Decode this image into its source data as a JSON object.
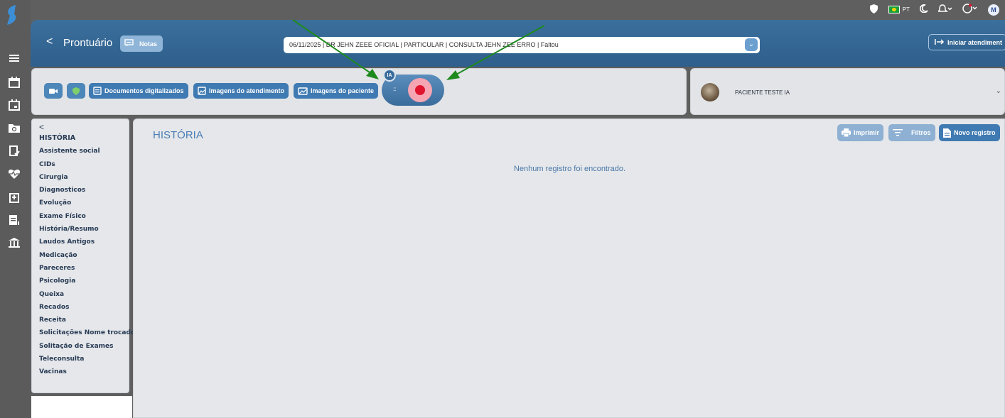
{
  "topbar": {
    "lang": "PT",
    "user_initial": "M"
  },
  "header": {
    "back_label": "<",
    "title": "Prontuário",
    "notas_label": "Notas",
    "consulta_value": "06/11/2025 | DR JEHN ZEEE OFICIAL | PARTICULAR | CONSULTA JEHN ZEE ERRO | Faltou",
    "iniciar_label": "Iniciar atendiment"
  },
  "toolbar": {
    "documentos_label": "Documentos digitalizados",
    "imagens_atendimento_label": "Imagens do atendimento",
    "imagens_paciente_label": "Imagens do paciente",
    "ia_badge": "IA"
  },
  "patient": {
    "name": "PACIENTE TESTE IA"
  },
  "menu": {
    "back": "<",
    "items": [
      "HISTÓRIA",
      "Assistente social",
      "CIDs",
      "Cirurgia",
      "Diagnosticos",
      "Evolução",
      "Exame Físico",
      "História/Resumo",
      "Laudos Antigos",
      "Medicação",
      "Pareceres",
      "Psicologia",
      "Queixa",
      "Recados",
      "Receita",
      "Solicitações Nome trocado",
      "Solitação de Exames",
      "Teleconsulta",
      "Vacinas"
    ]
  },
  "main": {
    "title": "HISTÓRIA",
    "empty_message": "Nenhum registro foi encontrado.",
    "imprimir_label": "Imprimir",
    "filtros_label": "Filtros",
    "novo_registro_label": "Novo registro"
  },
  "colors": {
    "header_blue": "#33658f",
    "button_blue": "#3f7ab2",
    "record_red": "#e0142e",
    "annotation_green": "#1e8a1e"
  }
}
